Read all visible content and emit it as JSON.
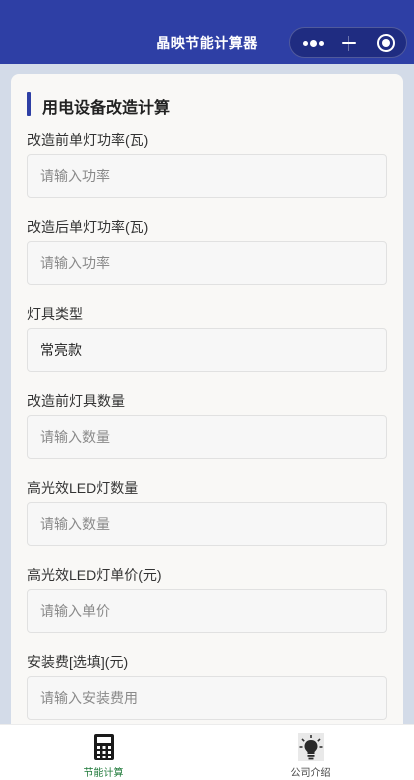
{
  "header": {
    "title": "晶映节能计算器",
    "background_color": "#2e3fa5",
    "capsule": {
      "more_icon": "more-dots-icon",
      "minimize_icon": "minus-icon",
      "close_icon": "target-ring-icon"
    }
  },
  "form": {
    "section_title": "用电设备改造计算",
    "fields": [
      {
        "label": "改造前单灯功率(瓦)",
        "placeholder": "请输入功率",
        "value": ""
      },
      {
        "label": "改造后单灯功率(瓦)",
        "placeholder": "请输入功率",
        "value": ""
      },
      {
        "label": "灯具类型",
        "placeholder": "",
        "value": "常亮款"
      },
      {
        "label": "改造前灯具数量",
        "placeholder": "请输入数量",
        "value": ""
      },
      {
        "label": "高光效LED灯数量",
        "placeholder": "请输入数量",
        "value": ""
      },
      {
        "label": "高光效LED灯单价(元)",
        "placeholder": "请输入单价",
        "value": ""
      },
      {
        "label": "安装费[选填](元)",
        "placeholder": "请输入安装费用",
        "value": ""
      }
    ]
  },
  "tabbar": {
    "tabs": [
      {
        "label": "节能计算",
        "icon": "calculator-icon",
        "active": true,
        "color": "#1f7a3a"
      },
      {
        "label": "公司介绍",
        "icon": "light-bulb-icon",
        "active": false,
        "color": "#444444"
      }
    ]
  }
}
